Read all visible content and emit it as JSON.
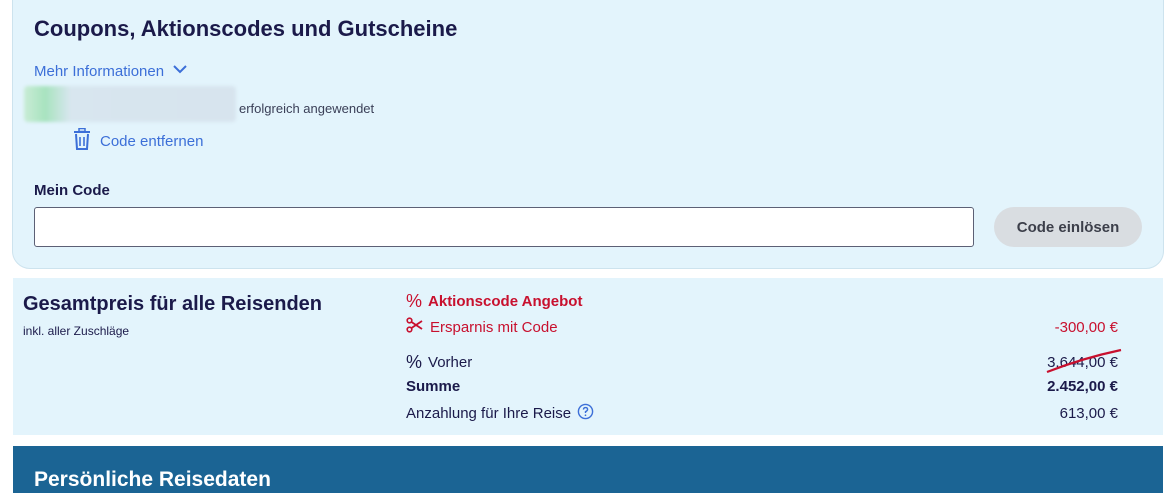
{
  "coupons": {
    "title": "Coupons, Aktionscodes und Gutscheine",
    "more_info_label": "Mehr Informationen",
    "applied_text": "erfolgreich angewendet",
    "remove_code_label": "Code entfernen",
    "code_label": "Mein Code",
    "code_value": "",
    "redeem_button_label": "Code einlösen"
  },
  "price": {
    "heading": "Gesamtpreis für alle Reisenden",
    "subheading": "inkl. aller Zuschläge",
    "promo_offer_label": "Aktionscode Angebot",
    "savings_label": "Ersparnis mit Code",
    "savings_value": "-300,00 €",
    "before_label": "Vorher",
    "before_value": "3.644,00 €",
    "total_label": "Summe",
    "total_value": "2.452,00 €",
    "deposit_label": "Anzahlung für Ihre Reise",
    "deposit_value": "613,00 €",
    "percent_symbol": "%"
  },
  "personal": {
    "title": "Persönliche Reisedaten"
  },
  "colors": {
    "accent_link": "#3c6fd8",
    "promo_red": "#c8102e",
    "panel_bg": "#e3f4fc",
    "header_blue": "#1b6494",
    "navy_text": "#1b1a4a"
  },
  "icons": {
    "more_info": "chevron-down-icon",
    "remove": "trash-icon",
    "promo": "percent-icon",
    "savings": "scissors-icon",
    "help": "question-circle-icon"
  }
}
